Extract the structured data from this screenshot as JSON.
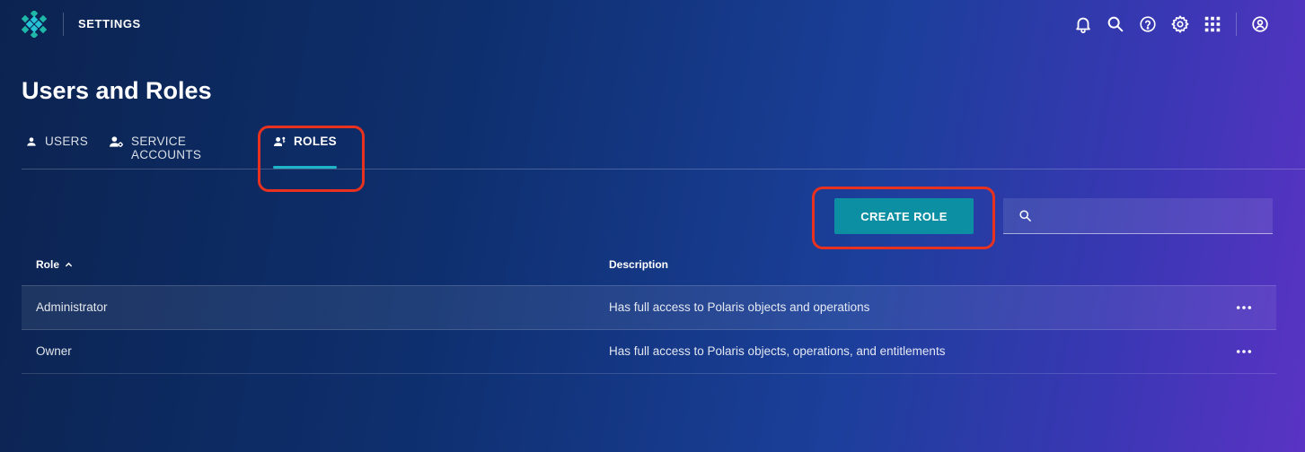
{
  "header": {
    "app_title": "SETTINGS",
    "icons": [
      "bell-icon",
      "search-icon",
      "help-icon",
      "gear-icon",
      "apps-grid-icon",
      "user-profile-icon"
    ]
  },
  "page": {
    "title": "Users and Roles"
  },
  "tabs": [
    {
      "label": "USERS",
      "icon": "user-icon",
      "active": false
    },
    {
      "label": "SERVICE ACCOUNTS",
      "icon": "service-account-icon",
      "active": false
    },
    {
      "label": "ROLES",
      "icon": "roles-icon",
      "active": true
    }
  ],
  "toolbar": {
    "create_label": "CREATE ROLE",
    "search_value": "",
    "search_placeholder": ""
  },
  "table": {
    "columns": [
      {
        "label": "Role",
        "sort": "ascending"
      },
      {
        "label": "Description"
      }
    ],
    "rows": [
      {
        "role": "Administrator",
        "description": "Has full access to Polaris objects and operations"
      },
      {
        "role": "Owner",
        "description": "Has full access to Polaris objects, operations, and entitlements"
      }
    ]
  },
  "colors": {
    "accent": "#1db5c7",
    "button": "#0d8fa3",
    "annotation": "#e8321f"
  }
}
